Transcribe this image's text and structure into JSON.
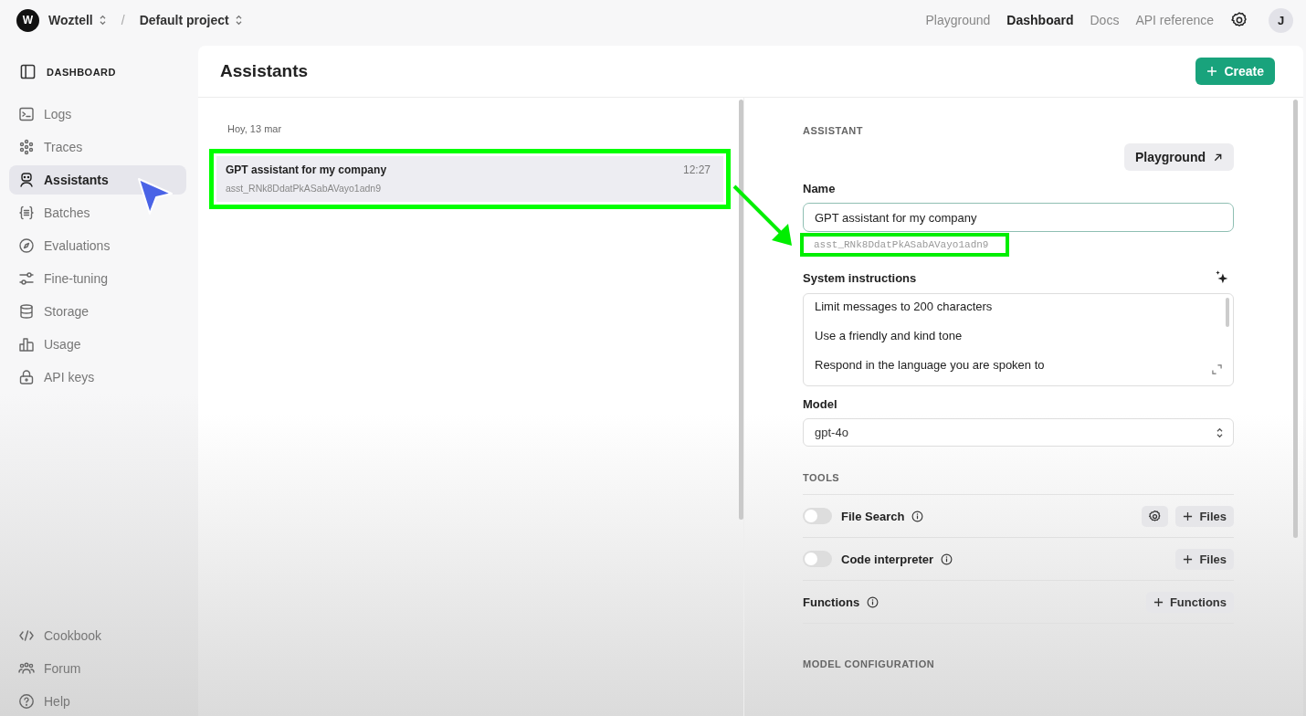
{
  "topbar": {
    "org_avatar": "W",
    "org": "Woztell",
    "separator": "/",
    "project": "Default project",
    "nav": [
      {
        "label": "Playground",
        "selected": false
      },
      {
        "label": "Dashboard",
        "selected": true
      },
      {
        "label": "Docs",
        "selected": false
      },
      {
        "label": "API reference",
        "selected": false
      }
    ],
    "user_avatar": "J"
  },
  "sidebar": {
    "title": "DASHBOARD",
    "items": [
      {
        "kind": "logs",
        "label": "Logs",
        "selected": false
      },
      {
        "kind": "traces",
        "label": "Traces",
        "selected": false
      },
      {
        "kind": "assistants",
        "label": "Assistants",
        "selected": true
      },
      {
        "kind": "batches",
        "label": "Batches",
        "selected": false
      },
      {
        "kind": "evaluations",
        "label": "Evaluations",
        "selected": false
      },
      {
        "kind": "finetuning",
        "label": "Fine-tuning",
        "selected": false
      },
      {
        "kind": "storage",
        "label": "Storage",
        "selected": false
      },
      {
        "kind": "usage",
        "label": "Usage",
        "selected": false
      },
      {
        "kind": "apikeys",
        "label": "API keys",
        "selected": false
      }
    ],
    "footer_items": [
      {
        "kind": "cookbook",
        "label": "Cookbook"
      },
      {
        "kind": "forum",
        "label": "Forum"
      },
      {
        "kind": "help",
        "label": "Help"
      }
    ]
  },
  "page": {
    "title": "Assistants",
    "create_button": "Create"
  },
  "list": {
    "date_heading": "Hoy, 13 mar",
    "items": [
      {
        "name": "GPT assistant for my company",
        "id": "asst_RNk8DdatPkASabAVayo1adn9",
        "time": "12:27",
        "selected": true,
        "highlighted": true
      }
    ]
  },
  "detail": {
    "section": "ASSISTANT",
    "playground_button": "Playground",
    "name_label": "Name",
    "name_value": "GPT assistant for my company",
    "id": "asst_RNk8DdatPkASabAVayo1adn9",
    "id_highlighted": true,
    "instructions_label": "System instructions",
    "instructions": [
      "Limit messages to 200 characters",
      "Use a friendly and kind tone",
      "Respond in the language you are spoken to"
    ],
    "model_label": "Model",
    "model_value": "gpt-4o",
    "tools_heading": "TOOLS",
    "tools": [
      {
        "kind": "toggle",
        "label": "File Search",
        "on": false,
        "buttons": [
          {
            "kind": "settings"
          },
          {
            "kind": "add",
            "label": "Files"
          }
        ]
      },
      {
        "kind": "toggle",
        "label": "Code interpreter",
        "on": false,
        "buttons": [
          {
            "kind": "add",
            "label": "Files"
          }
        ]
      },
      {
        "kind": "plain",
        "label": "Functions",
        "buttons": [
          {
            "kind": "add",
            "label": "Functions"
          }
        ]
      }
    ],
    "config_heading": "MODEL CONFIGURATION"
  }
}
